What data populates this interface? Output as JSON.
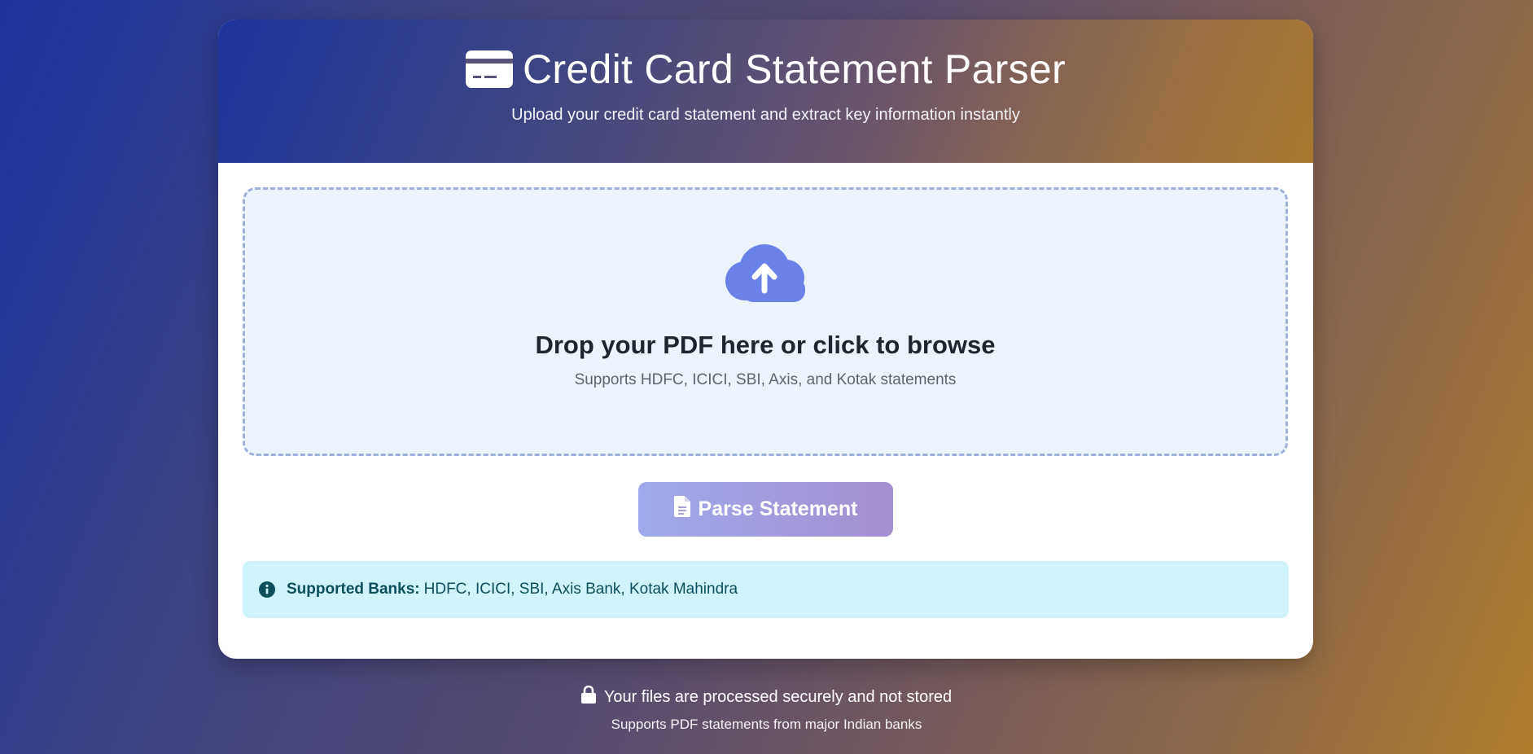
{
  "header": {
    "title": "Credit Card Statement Parser",
    "subtitle": "Upload your credit card statement and extract key information instantly",
    "icon": "credit-card-icon"
  },
  "dropzone": {
    "icon": "cloud-upload-icon",
    "title": "Drop your PDF here or click to browse",
    "subtitle": "Supports HDFC, ICICI, SBI, Axis, and Kotak statements"
  },
  "parse_button": {
    "icon": "file-icon",
    "label": "Parse Statement"
  },
  "info": {
    "icon": "info-circle-icon",
    "label": "Supported Banks:",
    "text": "HDFC, ICICI, SBI, Axis Bank, Kotak Mahindra"
  },
  "footer": {
    "icon": "lock-icon",
    "secure_text": "Your files are processed securely and not stored",
    "support_text": "Supports PDF statements from major Indian banks"
  },
  "colors": {
    "accent": "#6a81e8",
    "dropzone_bg": "#edf3fd",
    "info_bg": "#cff4fb",
    "info_text": "#0b4f5e"
  }
}
